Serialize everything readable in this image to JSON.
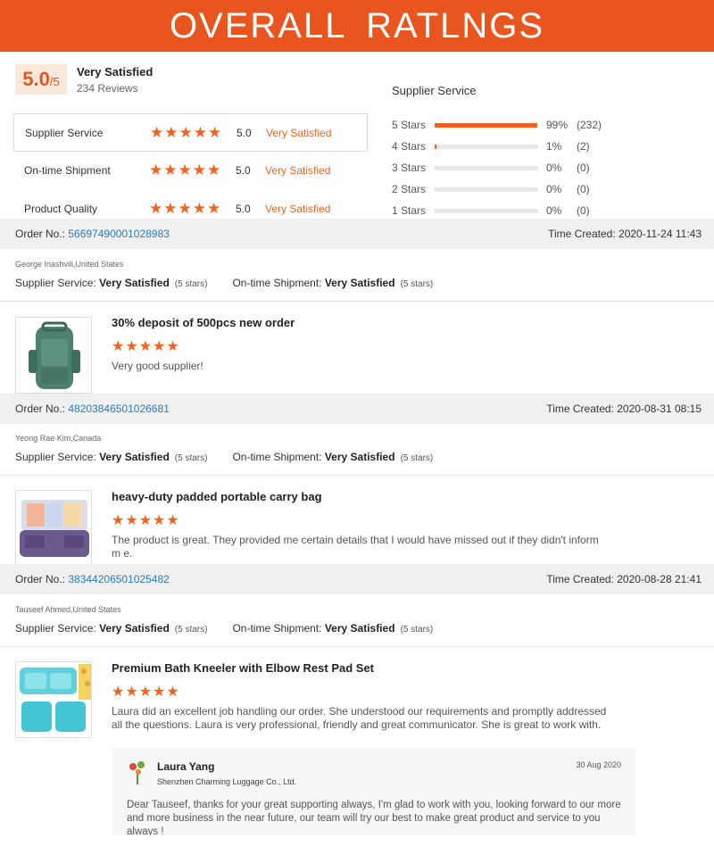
{
  "banner": {
    "title": "OVERALL  RATLNGS"
  },
  "summary": {
    "score": "5.0",
    "score_suffix": "/5",
    "label": "Very Satisfied",
    "reviews": "234 Reviews"
  },
  "metrics": [
    {
      "label": "Supplier Service",
      "stars": "★★★★★",
      "score": "5.0",
      "text": "Very Satisfied"
    },
    {
      "label": "On-time Shipment",
      "stars": "★★★★★",
      "score": "5.0",
      "text": "Very Satisfied"
    },
    {
      "label": "Product Quality",
      "stars": "★★★★★",
      "score": "5.0",
      "text": "Very Satisfied"
    }
  ],
  "breakdown": {
    "title": "Supplier Service",
    "rows": [
      {
        "label": "5 Stars",
        "fraction": 0.99,
        "pct": "99%",
        "count": "(232)"
      },
      {
        "label": "4 Stars",
        "fraction": 0.01,
        "pct": "1%",
        "count": "(2)"
      },
      {
        "label": "3 Stars",
        "fraction": 0,
        "pct": "0%",
        "count": "(0)"
      },
      {
        "label": "2 Stars",
        "fraction": 0,
        "pct": "0%",
        "count": "(0)"
      },
      {
        "label": "1 Stars",
        "fraction": 0,
        "pct": "0%",
        "count": "(0)"
      }
    ]
  },
  "labels": {
    "order_no": "Order No.:",
    "time_created": "Time Created:",
    "supplier_service": "Supplier Service:",
    "ontime_shipment": "On-time Shipment:",
    "very_satisfied": "Very Satisfied",
    "five_stars": "(5 stars)"
  },
  "reviews": [
    {
      "order_no": "56697490001028983",
      "time": "2020-11-24 11:43",
      "reviewer": "George Inashvili,United States",
      "product": "30% deposit of 500pcs new order",
      "stars": "★★★★★",
      "text": "Very good supplier!"
    },
    {
      "order_no": "48203846501026681",
      "time": "2020-08-31 08:15",
      "reviewer": "Yeong Rae Kim,Canada",
      "product": "heavy-duty padded portable carry bag",
      "stars": "★★★★★",
      "text": "The product is great. They provided me certain details that I would have missed out if they didn't inform m e."
    },
    {
      "order_no": "38344206501025482",
      "time": "2020-08-28 21:41",
      "reviewer": "Tauseef Ahmed,United States",
      "product": "Premium Bath Kneeler with Elbow Rest Pad Set",
      "stars": "★★★★★",
      "text": "Laura did an excellent job handling our order. She understood our requirements and promptly addressed all the questions. Laura is very professional, friendly and great communicator. She is great to work with."
    }
  ],
  "reply": {
    "name": "Laura Yang",
    "company": "Shenzhen Charming Luggage Co., Ltd.",
    "date": "30 Aug 2020",
    "text": "Dear Tauseef, thanks for your great supporting always, I'm glad to work with you, looking forward  to our more and more business in the near future, our team will try our best to make great product and service to you always !"
  },
  "colors": {
    "accent": "#e9551e",
    "star": "#f1631e",
    "link": "#2a7bbd"
  }
}
